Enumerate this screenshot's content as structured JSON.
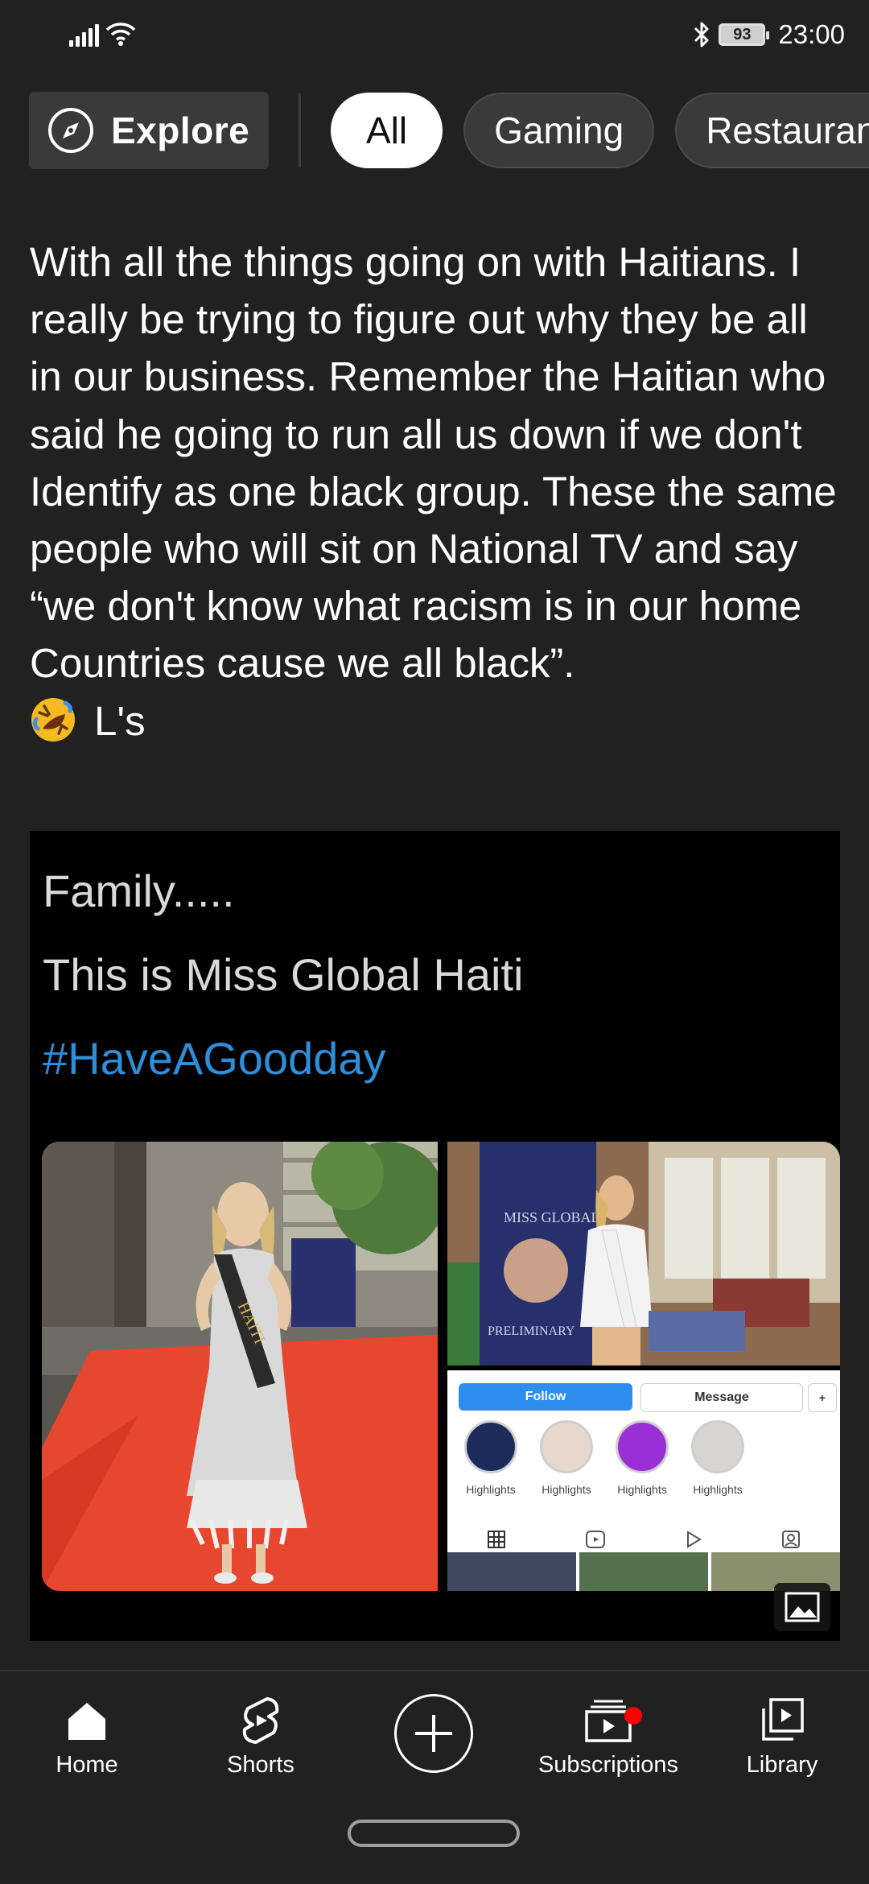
{
  "status_bar": {
    "time": "23:00",
    "battery_level": "93",
    "icons": [
      "signal-icon",
      "wifi-icon",
      "bluetooth-icon",
      "battery-icon"
    ]
  },
  "chips": {
    "explore_label": "Explore",
    "items": [
      "All",
      "Gaming",
      "Restaurants"
    ],
    "selected": "All"
  },
  "post": {
    "text": "With all the things going on with Haitians. I really be trying to figure out why they be all in our business. Remember the Haitian who said he going to run all us down if we don't Identify as one black group. These the same people who will sit on National TV and say “we don't know what racism is in our home Countries cause we all black”.",
    "emoji_icon": "rolling-on-floor-laughing-emoji",
    "suffix": "L's"
  },
  "image": {
    "line1": "Family.....",
    "line2": "This is Miss Global Haiti",
    "hashtag": "#HaveAGoodday",
    "sash_text": "HAITI",
    "banner_text": "MISS GLOBAL",
    "preliminary_text": "PRELIMINARY",
    "instagram": {
      "follow_label": "Follow",
      "message_label": "Message",
      "highlights": [
        "Highlights",
        "Highlights",
        "Highlights",
        "Highlights"
      ]
    }
  },
  "bottom_nav": {
    "items": [
      {
        "label": "Home",
        "icon": "home-icon"
      },
      {
        "label": "Shorts",
        "icon": "shorts-icon"
      },
      {
        "label": "",
        "icon": "create-icon"
      },
      {
        "label": "Subscriptions",
        "icon": "subscriptions-icon"
      },
      {
        "label": "Library",
        "icon": "library-icon"
      }
    ]
  },
  "colors": {
    "background": "#212121",
    "chip_active_bg": "#ffffff",
    "hashtag": "#2e8ed9",
    "notification_dot": "#ff0000",
    "red_carpet": "#e8472f",
    "ig_follow": "#2e8ef0"
  }
}
